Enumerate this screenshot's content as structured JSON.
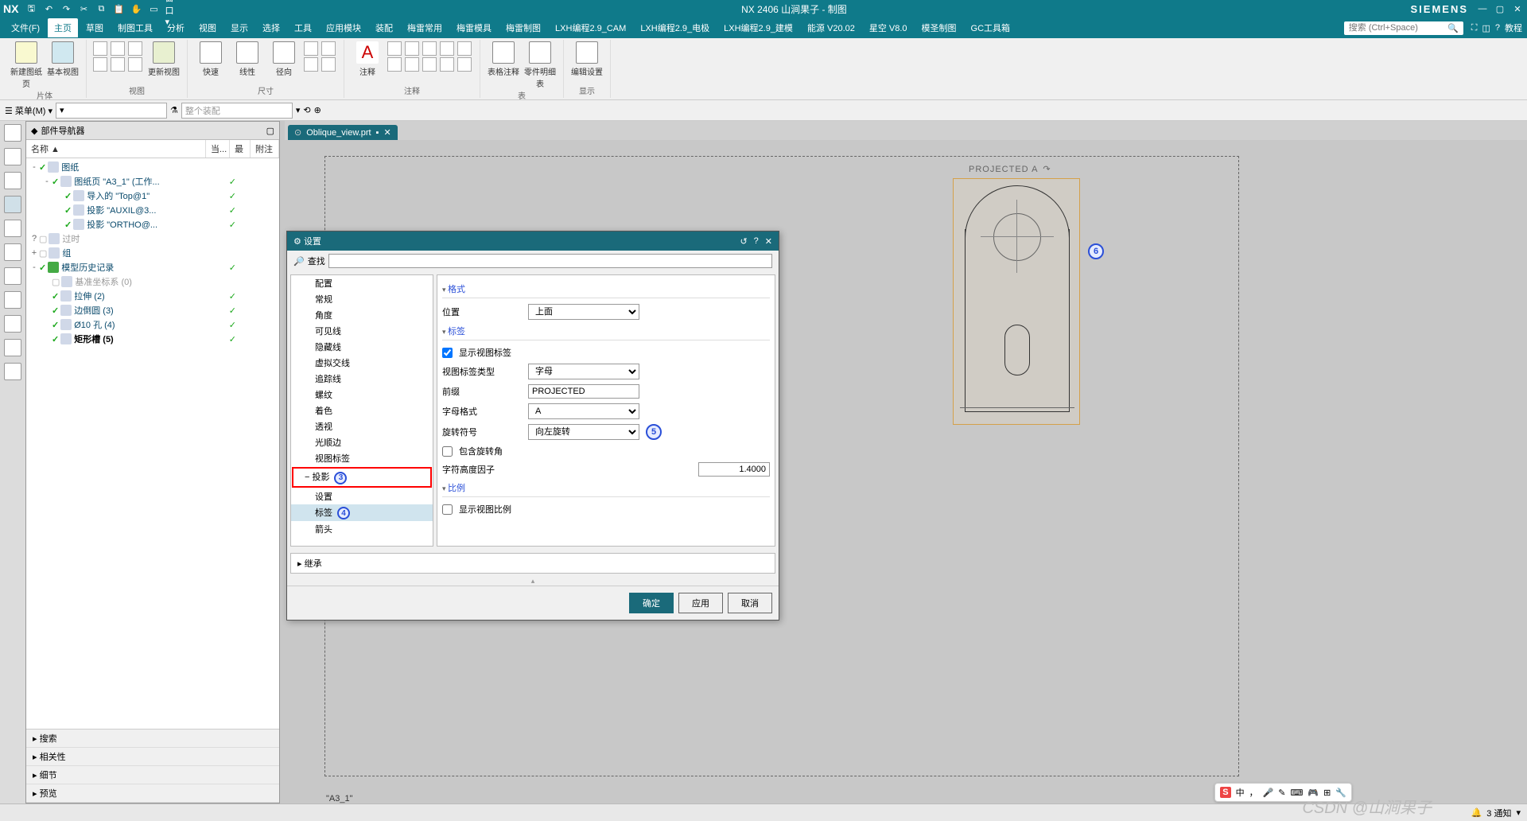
{
  "titlebar": {
    "logo": "NX",
    "title": "NX 2406 山涧果子 - 制图",
    "siemens": "SIEMENS"
  },
  "menubar": {
    "items": [
      "文件(F)",
      "主页",
      "草图",
      "制图工具",
      "分析",
      "视图",
      "显示",
      "选择",
      "工具",
      "应用模块",
      "装配",
      "梅雷常用",
      "梅雷模具",
      "梅雷制图",
      "LXH编程2.9_CAM",
      "LXH编程2.9_电极",
      "LXH编程2.9_建模",
      "能源 V20.02",
      "星空 V8.0",
      "模圣制图",
      "GC工具箱"
    ],
    "active_index": 1,
    "search_placeholder": "搜索 (Ctrl+Space)",
    "help_label": "教程"
  },
  "ribbon": {
    "groups": [
      {
        "label": "片体",
        "items": [
          {
            "label": "新建图纸页"
          },
          {
            "label": "基本视图"
          }
        ]
      },
      {
        "label": "视图",
        "items": [
          {
            "label": "更新视图"
          }
        ]
      },
      {
        "label": "尺寸",
        "items": [
          {
            "label": "快速"
          },
          {
            "label": "线性"
          },
          {
            "label": "径向"
          }
        ]
      },
      {
        "label": "注释",
        "items": [
          {
            "label": "注释"
          }
        ]
      },
      {
        "label": "表",
        "items": [
          {
            "label": "表格注释"
          },
          {
            "label": "零件明细表"
          }
        ]
      },
      {
        "label": "显示",
        "items": [
          {
            "label": "编辑设置"
          }
        ]
      }
    ]
  },
  "subbar": {
    "menu_label": "菜单(M)",
    "filter_placeholder": "整个装配"
  },
  "navigator": {
    "title": "部件导航器",
    "columns": [
      "名称 ▲",
      "当...",
      "最",
      "附注"
    ],
    "tree": [
      {
        "depth": 0,
        "exp": "-",
        "chk": true,
        "text": "图纸",
        "tick": false
      },
      {
        "depth": 1,
        "exp": "-",
        "chk": true,
        "text": "图纸页 \"A3_1\" (工作...",
        "tick": true
      },
      {
        "depth": 2,
        "exp": "",
        "chk": true,
        "text": "导入的 \"Top@1\"",
        "tick": true
      },
      {
        "depth": 2,
        "exp": "",
        "chk": true,
        "text": "投影 \"AUXIL@3...",
        "tick": true
      },
      {
        "depth": 2,
        "exp": "",
        "chk": true,
        "text": "投影 \"ORTHO@...",
        "tick": true
      },
      {
        "depth": 0,
        "exp": "?",
        "chk": false,
        "text": "过时",
        "gray": true
      },
      {
        "depth": 0,
        "exp": "+",
        "chk": false,
        "text": "组"
      },
      {
        "depth": 0,
        "exp": "-",
        "chk": true,
        "text": "模型历史记录",
        "tick": true,
        "green": true
      },
      {
        "depth": 1,
        "exp": "",
        "chk": false,
        "text": "基准坐标系 (0)",
        "gray": true
      },
      {
        "depth": 1,
        "exp": "",
        "chk": true,
        "text": "拉伸 (2)",
        "tick": true
      },
      {
        "depth": 1,
        "exp": "",
        "chk": true,
        "text": "边倒圆 (3)",
        "tick": true
      },
      {
        "depth": 1,
        "exp": "",
        "chk": true,
        "text": "Ø10 孔 (4)",
        "tick": true
      },
      {
        "depth": 1,
        "exp": "",
        "chk": true,
        "text": "矩形槽 (5)",
        "tick": true,
        "bold": true
      }
    ],
    "panels": [
      "搜索",
      "相关性",
      "细节",
      "预览"
    ]
  },
  "doctab": {
    "name": "Oblique_view.prt"
  },
  "canvas": {
    "projected_label": "PROJECTED A",
    "sheet_label": "\"A3_1\"",
    "annotation_6": "6"
  },
  "dialog": {
    "title": "设置",
    "search_label": "查找",
    "tree_items": [
      {
        "text": "配置",
        "lvl": 2
      },
      {
        "text": "常规",
        "lvl": 2
      },
      {
        "text": "角度",
        "lvl": 2
      },
      {
        "text": "可见线",
        "lvl": 2
      },
      {
        "text": "隐藏线",
        "lvl": 2
      },
      {
        "text": "虚拟交线",
        "lvl": 2
      },
      {
        "text": "追踪线",
        "lvl": 2
      },
      {
        "text": "螺纹",
        "lvl": 2
      },
      {
        "text": "着色",
        "lvl": 2
      },
      {
        "text": "透视",
        "lvl": 2
      },
      {
        "text": "光顺边",
        "lvl": 2
      },
      {
        "text": "视图标签",
        "lvl": 2
      },
      {
        "text": "投影",
        "lvl": 1,
        "hl": true,
        "ann": "3"
      },
      {
        "text": "设置",
        "lvl": 2
      },
      {
        "text": "标签",
        "lvl": 2,
        "sel": true,
        "ann": "4"
      },
      {
        "text": "箭头",
        "lvl": 2
      }
    ],
    "inherit_label": "继承",
    "sections": {
      "format": {
        "title": "格式",
        "position_label": "位置",
        "position_value": "上面"
      },
      "label": {
        "title": "标签",
        "show_label": "显示视图标签",
        "type_label": "视图标签类型",
        "type_value": "字母",
        "prefix_label": "前缀",
        "prefix_value": "PROJECTED",
        "letter_label": "字母格式",
        "letter_value": "A",
        "rotation_label": "旋转符号",
        "rotation_value": "向左旋转",
        "rotation_ann": "5",
        "include_angle": "包含旋转角",
        "height_label": "字符高度因子",
        "height_value": "1.4000"
      },
      "scale": {
        "title": "比例",
        "show_scale": "显示视图比例"
      }
    },
    "buttons": {
      "ok": "确定",
      "apply": "应用",
      "cancel": "取消"
    }
  },
  "statusbar": {
    "watermark": "CSDN @山涧果子",
    "notify": "3 通知"
  },
  "ime": {
    "mode": "中"
  }
}
